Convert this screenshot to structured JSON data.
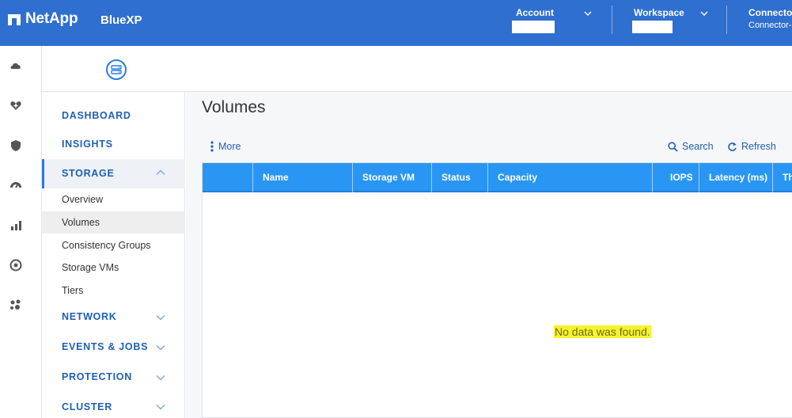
{
  "header": {
    "brand": "NetApp",
    "product": "BlueXP",
    "account_label": "Account",
    "workspace_label": "Workspace",
    "connector_label": "Connector",
    "connector_value": "Connector-"
  },
  "rail": {
    "icons": [
      "storage-cloud-icon",
      "health-icon",
      "protection-icon",
      "performance-icon",
      "analytics-icon",
      "governance-icon",
      "mobility-icon"
    ]
  },
  "nav": {
    "dashboard": "DASHBOARD",
    "insights": "INSIGHTS",
    "storage": "STORAGE",
    "storage_items": [
      "Overview",
      "Volumes",
      "Consistency Groups",
      "Storage VMs",
      "Tiers"
    ],
    "network": "NETWORK",
    "events_jobs": "EVENTS & JOBS",
    "protection": "PROTECTION",
    "cluster": "CLUSTER"
  },
  "main": {
    "title": "Volumes",
    "more_label": "More",
    "search_label": "Search",
    "refresh_label": "Refresh",
    "columns": [
      "",
      "Name",
      "Storage VM",
      "Status",
      "Capacity",
      "IOPS",
      "Latency (ms)",
      "Th"
    ],
    "empty_message": "No data was found."
  },
  "colors": {
    "topbar": "#2f6fd0",
    "accent": "#1f5fb5",
    "table_header": "#2a96f3",
    "highlight": "#f6f32a"
  }
}
